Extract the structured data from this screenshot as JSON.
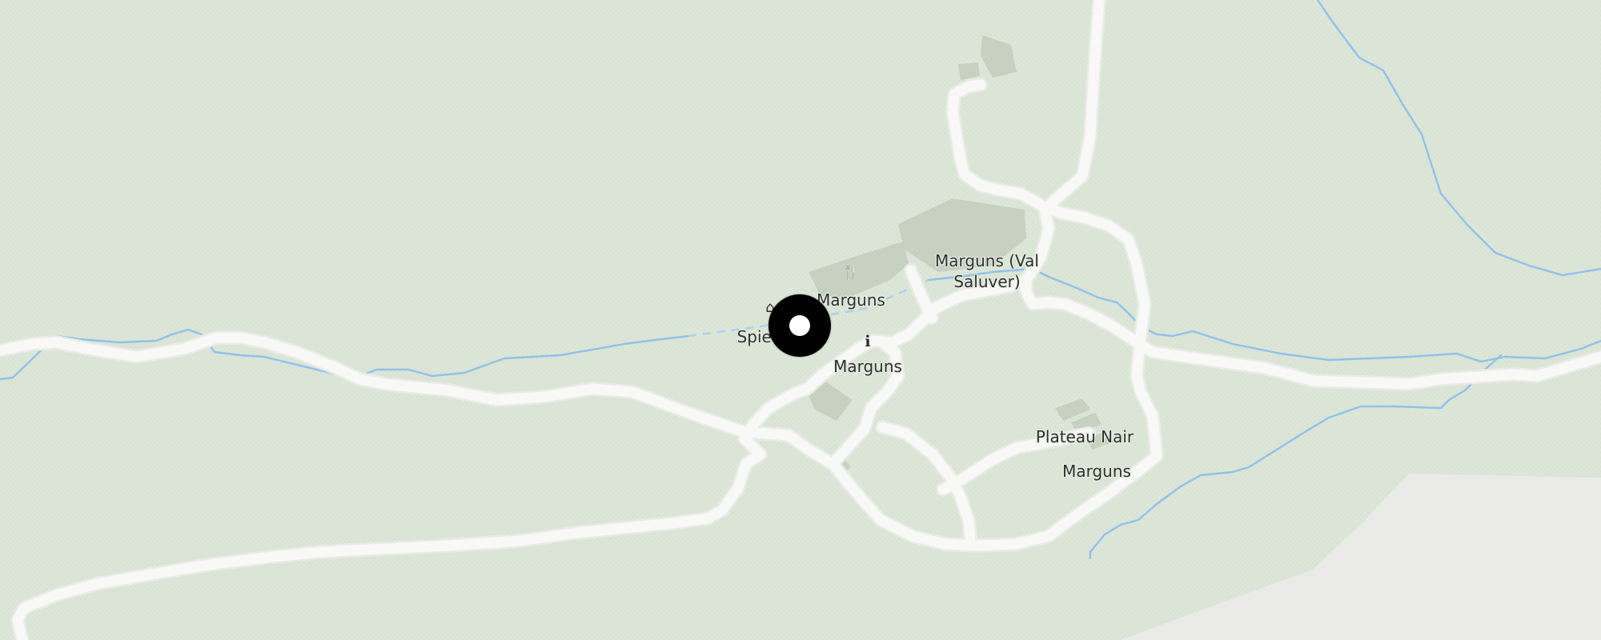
{
  "map": {
    "colors": {
      "land": "#dbe6d6",
      "road": "#f7f7f5",
      "water": "#8ec2ee",
      "building": "#c9d2c2",
      "rock": "#ebebe9",
      "marker": "#000000"
    },
    "labels": {
      "spiel": "Spiel",
      "marguns_restaurant": "Marguns",
      "marguns_val_saluver": "Marguns (Val\nSaluver)",
      "marguns_info": "Marguns",
      "plateau_nair": "Plateau Nair",
      "marguns_south": "Marguns"
    },
    "icons": {
      "restaurant": "restaurant-icon",
      "info": "info-icon",
      "playground": "playground-icon"
    },
    "icon_glyphs": {
      "restaurant": "🍴",
      "info": "i",
      "playground": "⌂"
    }
  }
}
